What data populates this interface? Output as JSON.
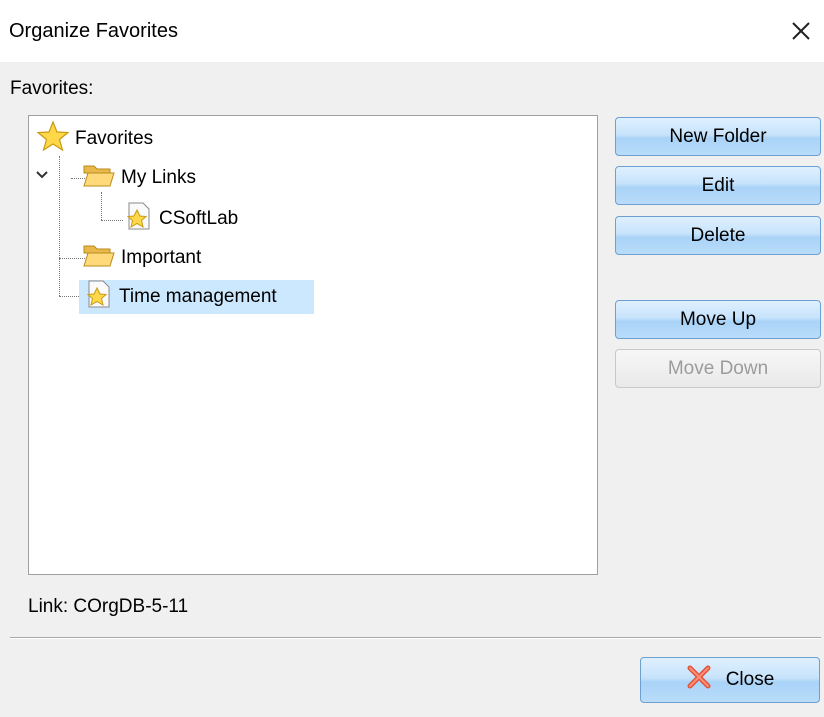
{
  "window": {
    "title": "Organize Favorites"
  },
  "favorites_label": "Favorites:",
  "tree": {
    "root": "Favorites",
    "items": [
      {
        "label": "My Links",
        "icon": "folder-open-icon",
        "expanded": true
      },
      {
        "label": "CSoftLab",
        "icon": "favorite-link-icon"
      },
      {
        "label": "Important",
        "icon": "folder-open-icon"
      },
      {
        "label": "Time management",
        "icon": "favorite-link-icon",
        "selected": true
      }
    ]
  },
  "buttons": {
    "new_folder": "New Folder",
    "edit": "Edit",
    "delete": "Delete",
    "move_up": "Move Up",
    "move_down": "Move Down"
  },
  "link_text": "Link: COrgDB-5-11",
  "close_label": "Close",
  "colors": {
    "selection": "#cce8ff",
    "button_border": "#6e9fd1",
    "disabled_text": "#9c9c9c"
  }
}
